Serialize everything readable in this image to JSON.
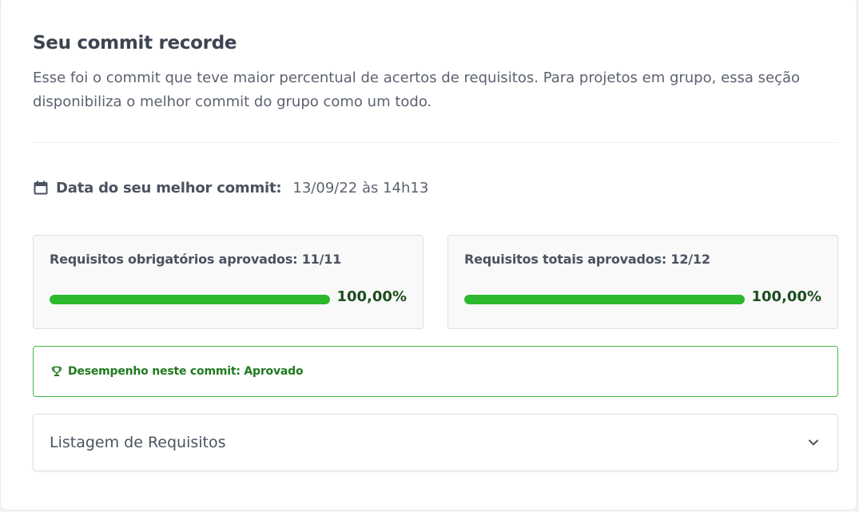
{
  "section": {
    "title": "Seu commit recorde",
    "description": "Esse foi o commit que teve maior percentual de acertos de requisitos. Para projetos em grupo, essa seção disponibiliza o melhor commit do grupo como um todo."
  },
  "best_commit": {
    "icon": "calendar-icon",
    "label": "Data do seu melhor commit:",
    "value": "13/09/22 às 14h13"
  },
  "stats": [
    {
      "label": "Requisitos obrigatórios aprovados: 11/11",
      "progress_percent": 100,
      "percent_text": "100,00%"
    },
    {
      "label": "Requisitos totais aprovados: 12/12",
      "progress_percent": 100,
      "percent_text": "100,00%"
    }
  ],
  "performance": {
    "icon": "trophy-icon",
    "text": "Desempenho neste commit: Aprovado"
  },
  "requirements_list": {
    "label": "Listagem de Requisitos",
    "icon": "chevron-down-icon"
  },
  "colors": {
    "progress_fill": "#2db82d",
    "success_text": "#1f7a1f",
    "success_border": "#48b948",
    "percent_text": "#1e4d1e"
  }
}
